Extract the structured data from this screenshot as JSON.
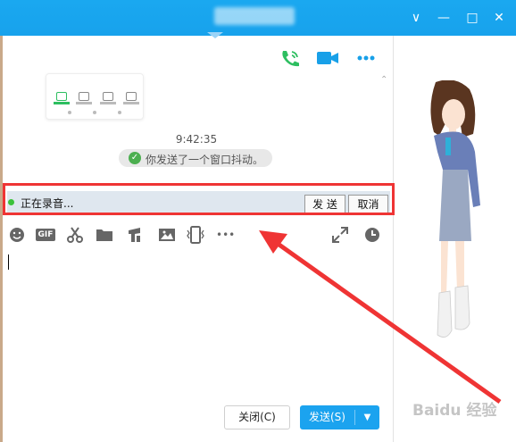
{
  "window": {
    "controls": {
      "minimize": "—",
      "maximize": "□",
      "close": "✕",
      "dropdown": "∨"
    }
  },
  "chat": {
    "timestamp": "9:42:35",
    "system_message": "你发送了一个窗口抖动。",
    "collapse_glyph": "⌃"
  },
  "recording": {
    "status": "正在录音...",
    "send_label": "发 送",
    "cancel_label": "取消"
  },
  "editor_toolbar": {
    "gif_label": "GIF",
    "more_label": "•••"
  },
  "footer": {
    "close_label": "关闭(C)",
    "send_label": "发送(S)",
    "send_menu_glyph": "▼"
  },
  "watermark": "Baidu 经验",
  "colors": {
    "titlebar": "#17a2ec",
    "highlight": "#ef3434",
    "send_button": "#1ba3ef",
    "call_green": "#2dbe60",
    "video_blue": "#18a0e8"
  }
}
